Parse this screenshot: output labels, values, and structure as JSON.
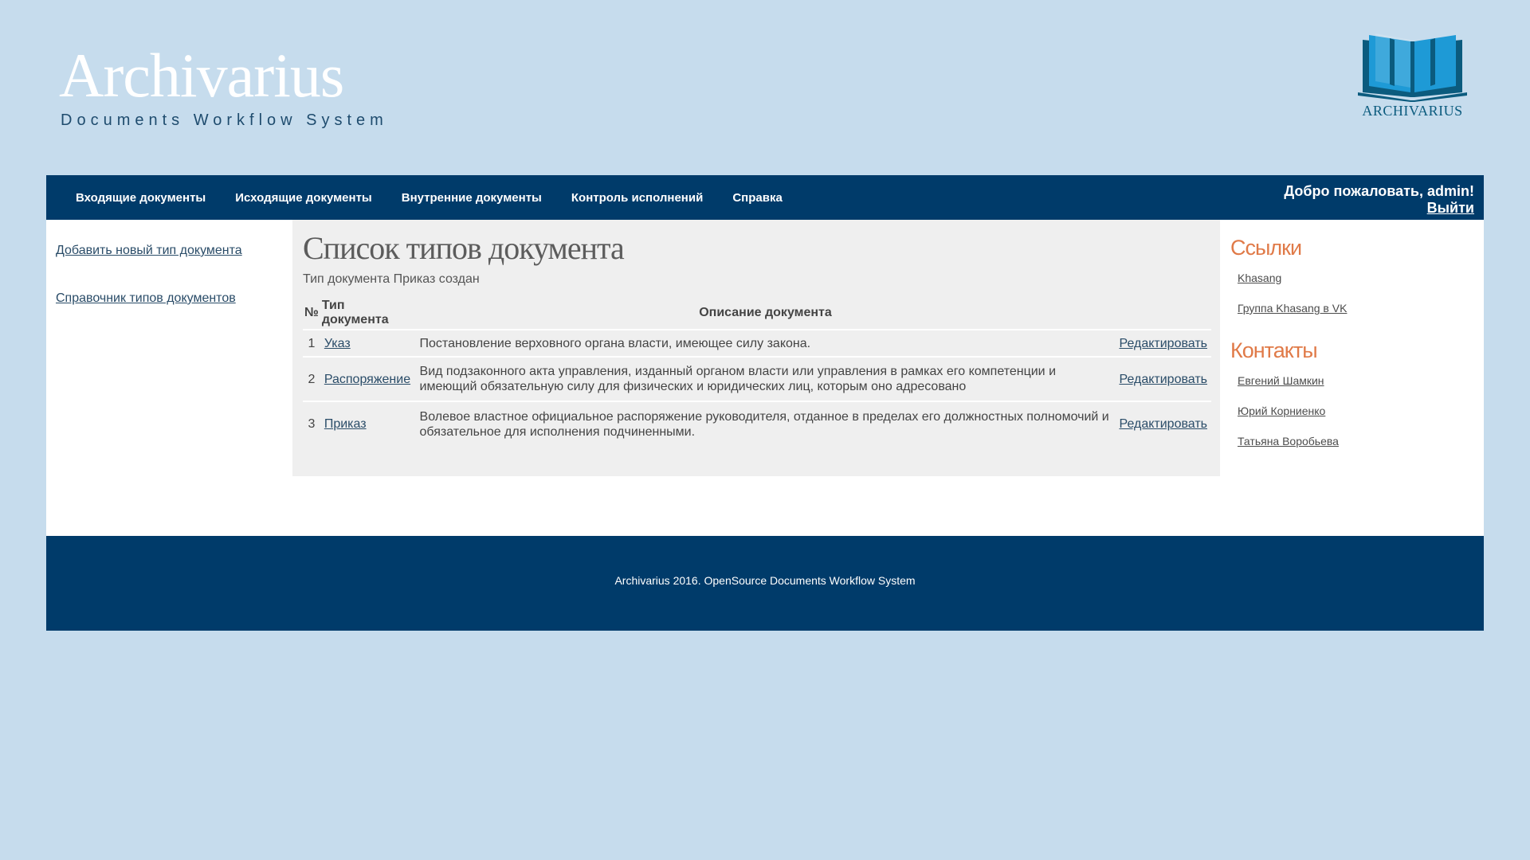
{
  "header": {
    "logo_title": "Archivarius",
    "logo_subtitle": "Documents Workflow System",
    "logo_caption": "ARCHIVARIUS",
    "logo_icon": "book-logo-icon",
    "logo_color": "#0b5b7e"
  },
  "nav": {
    "items": [
      {
        "label": "Входящие документы"
      },
      {
        "label": "Исходящие документы"
      },
      {
        "label": "Внутренние документы"
      },
      {
        "label": "Контроль исполнений"
      },
      {
        "label": "Справка"
      }
    ],
    "welcome": "Добро пожаловать, admin!",
    "logout": "Выйти"
  },
  "sidebar": {
    "links": [
      {
        "label": "Добавить новый тип документа"
      },
      {
        "label": "Справочник типов документов"
      }
    ]
  },
  "main": {
    "title": "Список типов документа",
    "status": "Тип документа Приказ создан",
    "columns": {
      "num": "№",
      "type": "Тип документа",
      "description": "Описание документа"
    },
    "rows": [
      {
        "num": "1",
        "type": "Указ",
        "description": "Постановление верховного органа власти, имеющее силу закона.",
        "action": "Редактировать"
      },
      {
        "num": "2",
        "type": "Распоряжение",
        "description": "Вид подзаконного акта управления, изданный органом власти или управления в рамках его компетенции и имеющий обязательную силу для физических и юридических лиц, которым оно адресовано",
        "action": "Редактировать"
      },
      {
        "num": "3",
        "type": "Приказ",
        "description": "Волевое властное официальное распоряжение руководителя, отданное в пределах его должностных полномочий и обязательное для исполнения подчиненными.",
        "action": "Редактировать"
      }
    ]
  },
  "rightbar": {
    "links_heading": "Ссылки",
    "links": [
      {
        "label": "Khasang"
      },
      {
        "label": "Группа Khasang в VK"
      }
    ],
    "contacts_heading": "Контакты",
    "contacts": [
      {
        "label": "Евгений Шамкин"
      },
      {
        "label": "Юрий Корниенко"
      },
      {
        "label": "Татьяна Воробьева"
      }
    ]
  },
  "footer": {
    "text": "Archivarius 2016. OpenSource Documents Workflow System"
  },
  "colors": {
    "page_bg": "#c6dced",
    "nav_bg": "#003b6a",
    "accent_heading": "#e07a48",
    "main_bg": "#efefef"
  }
}
